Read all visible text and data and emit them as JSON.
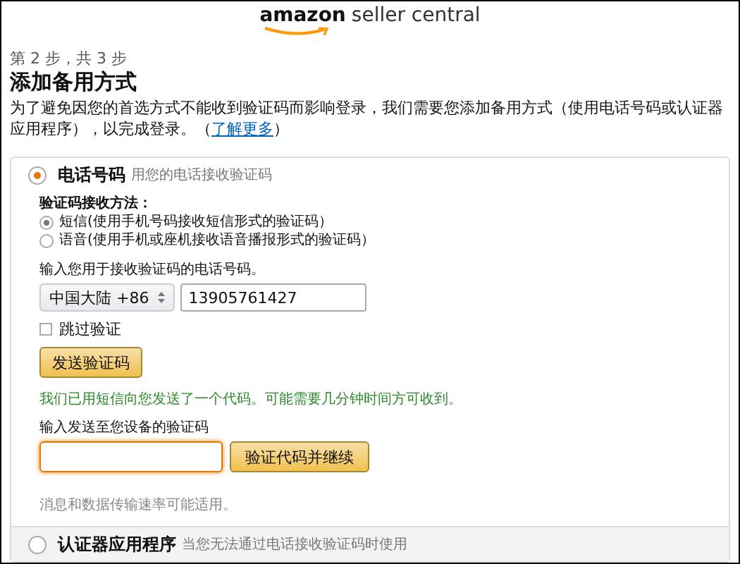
{
  "header": {
    "brand": "amazon",
    "product": "seller central"
  },
  "step": "第 2 步，共 3 步",
  "title": "添加备用方式",
  "intro": {
    "text": "为了避免因您的首选方式不能收到验证码而影响登录，我们需要您添加备用方式（使用电话号码或认证器应用程序），以完成登录。（",
    "link": "了解更多",
    "after": "）"
  },
  "options": [
    {
      "label": "电话号码",
      "hint": "用您的电话接收验证码",
      "selected": true
    },
    {
      "label": "认证器应用程序",
      "hint": "当您无法通过电话接收验证码时使用",
      "selected": false
    }
  ],
  "phone_form": {
    "method_label": "验证码接收方法：",
    "methods": [
      {
        "label": "短信(使用手机号码接收短信形式的验证码）",
        "selected": true
      },
      {
        "label": "语音(使用手机或座机接收语音播报形式的验证码）",
        "selected": false
      }
    ],
    "phone_label": "输入您用于接收验证码的电话号码。",
    "country": "中国大陆 +86",
    "phone": "13905761427",
    "skip": {
      "label": "跳过验证",
      "checked": false
    },
    "send_button": "发送验证码",
    "sent_message": "我们已用短信向您发送了一个代码。可能需要几分钟时间方可收到。",
    "code_label": "输入发送至您设备的验证码",
    "verify_button": "验证代码并继续",
    "rates_note": "消息和数据传输速率可能适用。"
  }
}
